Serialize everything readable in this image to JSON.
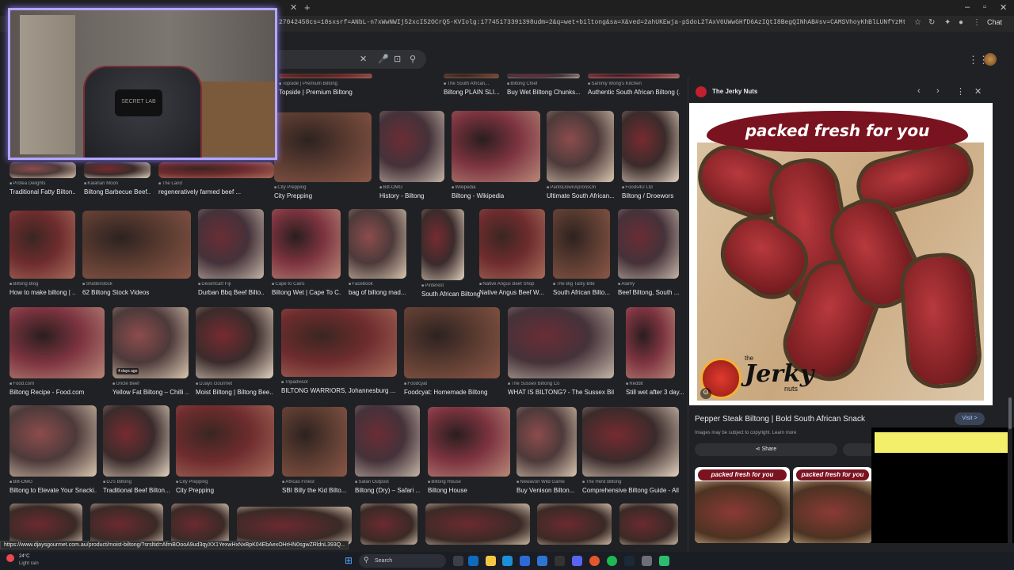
{
  "browser": {
    "tab_close": "✕",
    "new_tab": "+",
    "url": "27042458cs=18sxsrf=ANbL-n7xWwNWIj52xcI52OCrQ5-KVIolg:17745173391398udm=2&q=wet+biltong&sa=X&ved=2ahUKEwja-pSdoL2TAxV6UWwGHfD6AzIQtI8BegQINhAB#sv=CAMSVhoyKhBlLUNfYzMtY3VpYmgyWXNNMg5DX2MzLWN1aWJoMllzT...",
    "chat_label": "Chat"
  },
  "search": {
    "clear_icon": "✕",
    "mic_icon": "🎤",
    "lens_icon": "⊡",
    "search_icon": "⚲"
  },
  "webcam": {
    "chair_brand": "SECRET LAB"
  },
  "results": [
    {
      "source": "Topside | Premium Biltong",
      "title": "Topside | Premium Biltong"
    },
    {
      "source": "The South African...",
      "title": "Biltong PLAIN SLI..."
    },
    {
      "source": "Biltong Chief",
      "title": "Buy Wet Biltong Chunks..."
    },
    {
      "source": "Sammy Wong's Kitchen",
      "title": "Authentic South African Biltong (..."
    },
    {
      "source": "Protea Delights",
      "title": "Traditional Fatty Bilton..."
    },
    {
      "source": "Kalahari Moon",
      "title": "Biltong Barbecue Beef..."
    },
    {
      "source": "The Land",
      "title": "regeneratively farmed beef ..."
    },
    {
      "source": "City Prepping",
      "title": "City Prepping"
    },
    {
      "source": "Bilt-OMG",
      "title": "History - Biltong"
    },
    {
      "source": "Wikipedia",
      "title": "Biltong - Wikipedia"
    },
    {
      "source": "PantsDownApronsOn",
      "title": "Ultimate South African..."
    },
    {
      "source": "Foods4U Ltd",
      "title": "Biltong / Droewors"
    },
    {
      "source": "Biltong Blog",
      "title": "How to make biltong | ..."
    },
    {
      "source": "Shutterstock",
      "title": "62 Biltong Stock Videos"
    },
    {
      "source": "Desertcart Fiji",
      "title": "Durban Bbq Beef Bilto..."
    },
    {
      "source": "Cape to Cairo",
      "title": "Biltong Wet | Cape To C..."
    },
    {
      "source": "Facebook",
      "title": "bag of biltong mad..."
    },
    {
      "source": "Pinterest",
      "title": "South African Biltong"
    },
    {
      "source": "Native Angus Beef Shop",
      "title": "Native Angus Beef W..."
    },
    {
      "source": "The Big Tasty Bite",
      "title": "South African Bilto..."
    },
    {
      "source": "Alamy",
      "title": "Beef Biltong, South ..."
    },
    {
      "source": "Food.com",
      "title": "Biltong Recipe - Food.com"
    },
    {
      "source": "Uncle Beef",
      "title": "Yellow Fat Biltong – Chilli ..."
    },
    {
      "source": "DJays Gourmet",
      "title": "Moist Biltong | Biltong Bee..."
    },
    {
      "source": "Tripadvisor",
      "title": "BILTONG WARRIORS, Johannesburg ..."
    },
    {
      "source": "Foodcyat",
      "title": "Foodcyat: Homemade Biltong"
    },
    {
      "source": "The Sussex Biltong Co",
      "title": "WHAT IS BILTONG? - The Sussex Bilt..."
    },
    {
      "source": "Reddit",
      "title": "Still wet after 3 day..."
    },
    {
      "source": "Bilt-OMG",
      "title": "Biltong to Elevate Your Snacki..."
    },
    {
      "source": "DJ's Biltong",
      "title": "Traditional Beef Bilton..."
    },
    {
      "source": "City Prepping",
      "title": "City Prepping"
    },
    {
      "source": "Africas Finest",
      "title": "SBI Billy the Kid Bilto..."
    },
    {
      "source": "Safari Outpost",
      "title": "Biltong (Dry) – Safari ..."
    },
    {
      "source": "Biltong House",
      "title": "Biltong House"
    },
    {
      "source": "Newavon Wild Game",
      "title": "Buy Venison Bilton..."
    },
    {
      "source": "The Herd Biltong",
      "title": "Comprehensive Biltong Guide - All..."
    }
  ],
  "badges": {
    "days_ago": "4 days ago"
  },
  "panel": {
    "site": "The Jerky Nuts",
    "prev_icon": "‹",
    "next_icon": "›",
    "more_icon": "⋮",
    "close_icon": "✕",
    "banner": "packed fresh for you",
    "logo_the": "the",
    "logo_brand": "Jerky",
    "logo_nuts": "nuts",
    "title": "Pepper Steak Biltong | Bold South African Snack",
    "visit": "Visit >",
    "note": "Images may be subject to copyright. Learn more",
    "share": "Share",
    "related_banner": "packed fresh for you"
  },
  "status_url": "https://www.djaysgourmet.com.au/product/moist-biltong/?srsltid=AfmBOooA9ud3qyXX1YexwHxNxBpK04EbAexOHrHN0sgwZRldnL393Q...",
  "taskbar": {
    "temp": "24°C",
    "condition": "Light rain",
    "search": "Search"
  }
}
